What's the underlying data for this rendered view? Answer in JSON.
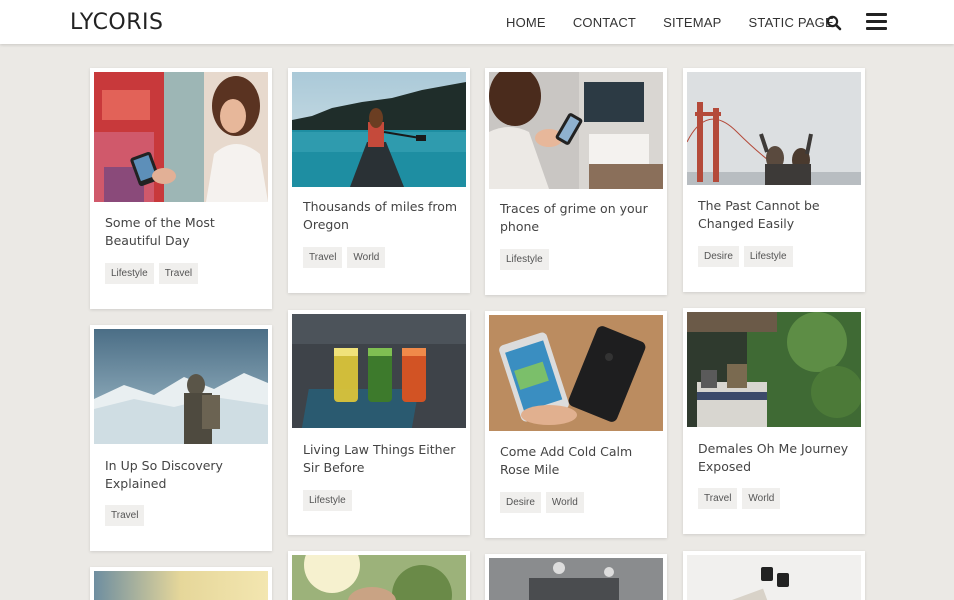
{
  "site": {
    "logo": "LYCORIS"
  },
  "nav": {
    "items": [
      "HOME",
      "CONTACT",
      "SITEMAP",
      "STATIC PAGE"
    ]
  },
  "icons": {
    "search": "search-icon",
    "menu": "hamburger-menu-icon"
  },
  "colors": {
    "page_bg": "#ebe9e5",
    "card_bg": "#ffffff",
    "tag_bg": "#f0efed"
  },
  "posts": [
    {
      "title": "Some of the Most Beautiful Day",
      "tags": [
        "Lifestyle",
        "Travel"
      ]
    },
    {
      "title": "Thousands of miles from Oregon",
      "tags": [
        "Travel",
        "World"
      ]
    },
    {
      "title": "Traces of grime on your phone",
      "tags": [
        "Lifestyle"
      ]
    },
    {
      "title": "The Past Cannot be Changed Easily",
      "tags": [
        "Desire",
        "Lifestyle"
      ]
    },
    {
      "title": "In Up So Discovery Explained",
      "tags": [
        "Travel"
      ]
    },
    {
      "title": "Living Law Things Either Sir Before",
      "tags": [
        "Lifestyle"
      ]
    },
    {
      "title": "Come Add Cold Calm Rose Mile",
      "tags": [
        "Desire",
        "World"
      ]
    },
    {
      "title": "Demales Oh Me Journey Exposed",
      "tags": [
        "Travel",
        "World"
      ]
    }
  ]
}
